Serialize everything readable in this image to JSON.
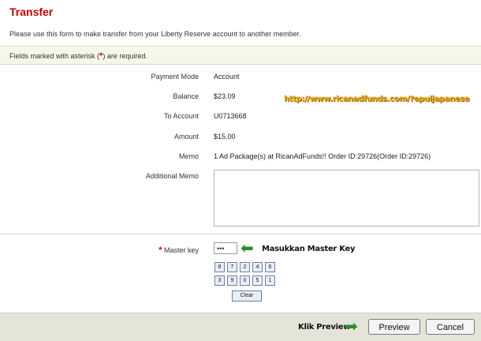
{
  "page": {
    "title": "Transfer",
    "description": "Please use this form to make transfer from your Liberty Reserve account to another member."
  },
  "required_note": {
    "prefix": "Fields marked with asterisk (",
    "star": "*",
    "suffix": ") are required."
  },
  "form": {
    "payment_mode": {
      "label": "Payment Mode",
      "value": "Account"
    },
    "balance": {
      "label": "Balance",
      "value": "$23.09"
    },
    "to_account": {
      "label": "To Account",
      "value": "U0713668"
    },
    "amount": {
      "label": "Amount",
      "value": "$15.00"
    },
    "memo": {
      "label": "Memo",
      "value": "1 Ad Package(s) at RicanAdFunds!! Order ID:29726(Order ID:29726)"
    },
    "additional_memo": {
      "label": "Additional Memo",
      "value": ""
    },
    "master_key": {
      "star": "*",
      "label": "Master key",
      "value": "•••"
    }
  },
  "keypad": {
    "row1": [
      "8",
      "7",
      "2",
      "4",
      "6"
    ],
    "row2": [
      "3",
      "9",
      "0",
      "5",
      "1"
    ],
    "clear": "Clear"
  },
  "annotations": {
    "url": "http://www.ricanadfunds.com/?epuljapanese",
    "master_key_note": "Masukkan Master Key",
    "preview_note": "Klik Preview"
  },
  "buttons": {
    "preview": "Preview",
    "cancel": "Cancel"
  }
}
